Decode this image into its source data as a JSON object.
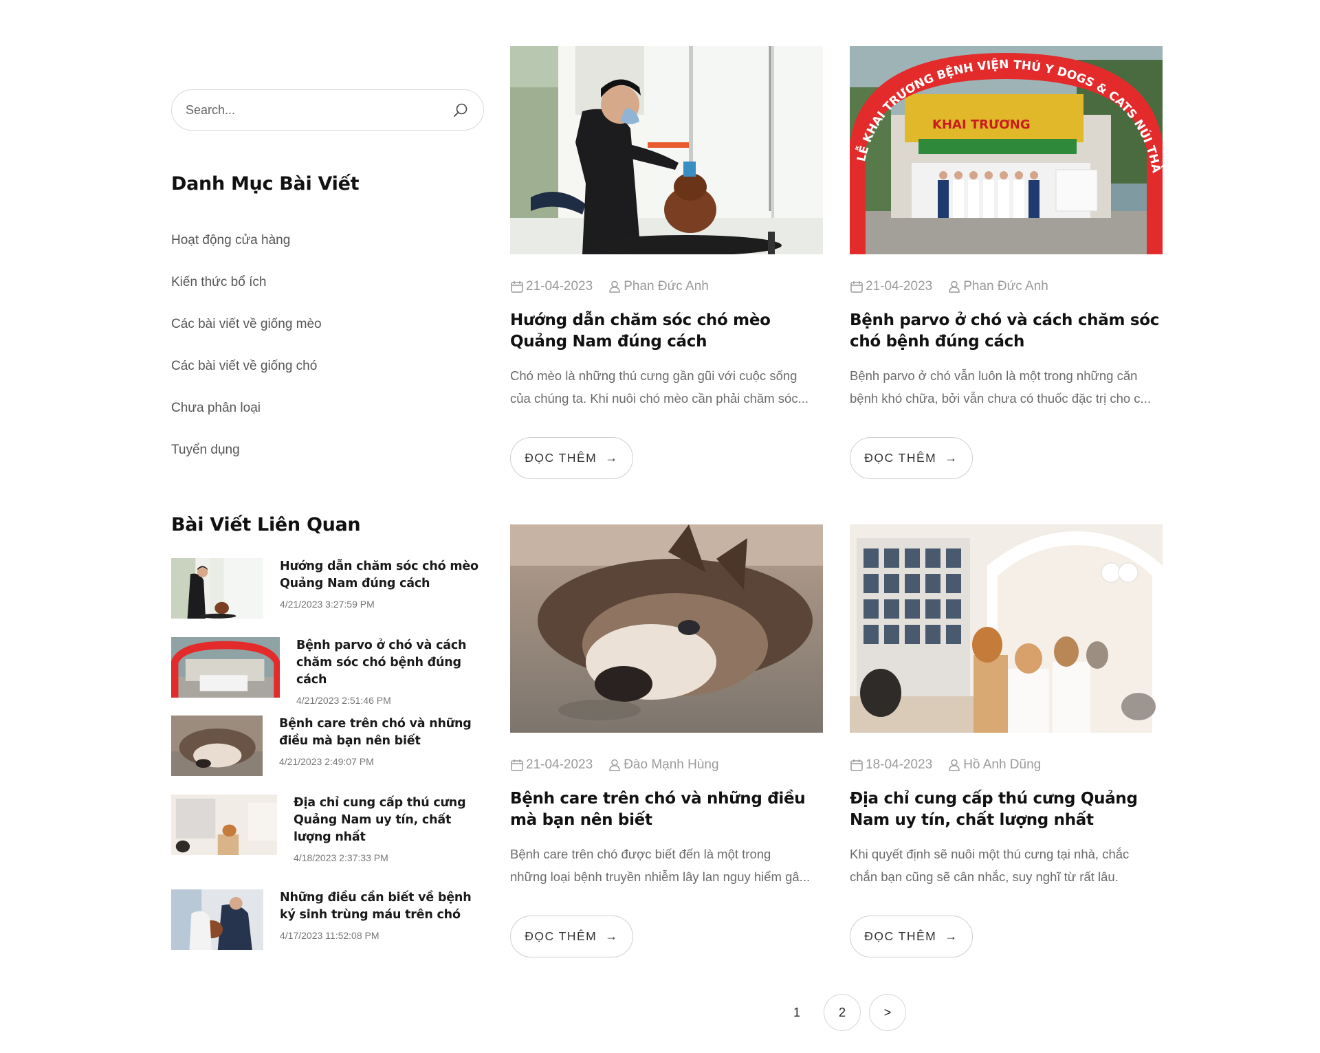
{
  "sidebar": {
    "search": {
      "placeholder": "Search..."
    },
    "categories_title": "Danh Mục Bài Viết",
    "categories": [
      "Hoạt động cửa hàng",
      "Kiến thức bổ ích",
      "Các bài viết về giống mèo",
      "Các bài viết về giống chó",
      "Chưa phân loại",
      "Tuyển dụng"
    ],
    "related_title": "Bài Viết Liên Quan",
    "related": [
      {
        "title": "Hướng dẫn chăm sóc chó mèo Quảng Nam đúng cách",
        "date": "4/21/2023 3:27:59 PM"
      },
      {
        "title": "Bệnh parvo ở chó và cách chăm sóc chó bệnh đúng cách",
        "date": "4/21/2023 2:51:46 PM"
      },
      {
        "title": "Bệnh care trên chó và những điều mà bạn nên biết",
        "date": "4/21/2023 2:49:07 PM"
      },
      {
        "title": "Địa chỉ cung cấp thú cưng Quảng Nam uy tín, chất lượng nhất",
        "date": "4/18/2023 2:37:33 PM"
      },
      {
        "title": "Những điều cần biết về bệnh ký sinh trùng máu trên chó",
        "date": "4/17/2023 11:52:08 PM"
      }
    ]
  },
  "posts": [
    {
      "date": "21-04-2023",
      "author": "Phan Đức Anh",
      "title": "Hướng dẫn chăm sóc chó mèo Quảng Nam đúng cách",
      "excerpt_line1": "Chó mèo là những thú cưng gần gũi với cuộc sống",
      "excerpt_line2": "của chúng ta. Khi nuôi chó mèo cần phải chăm sóc...",
      "read_more": "ĐỌC THÊM"
    },
    {
      "date": "21-04-2023",
      "author": "Phan Đức Anh",
      "title": "Bệnh parvo ở chó và cách chăm sóc chó bệnh đúng cách",
      "excerpt_line1": "Bệnh parvo ở chó vẫn luôn là một trong những căn",
      "excerpt_line2": "bệnh khó chữa, bởi vẫn chưa có thuốc đặc trị cho c...",
      "read_more": "ĐỌC THÊM",
      "image_banner_text": "LỄ KHAI TRƯƠNG BỆNH VIỆN THÚ Y DOGS & CATS NÚI THÀNH",
      "image_sign_text": "KHAI TRƯƠNG"
    },
    {
      "date": "21-04-2023",
      "author": "Đào Mạnh Hùng",
      "title": "Bệnh care trên chó và những điều mà bạn nên biết",
      "excerpt_line1": "Bệnh care trên chó được biết đến là một trong",
      "excerpt_line2": "những loại bệnh truyền nhiễm lây lan nguy hiểm gâ...",
      "read_more": "ĐỌC THÊM"
    },
    {
      "date": "18-04-2023",
      "author": "Hồ Anh Dũng",
      "title": "Địa chỉ cung cấp thú cưng Quảng Nam uy tín, chất lượng nhất",
      "excerpt_line1": "Khi quyết định sẽ nuôi một thú cưng tại nhà, chắc",
      "excerpt_line2": "chắn bạn cũng sẽ cân nhắc, suy nghĩ từ rất lâu.",
      "read_more": "ĐỌC THÊM"
    }
  ],
  "pagination": {
    "pages": [
      "1",
      "2"
    ],
    "current": "1",
    "next_label": ">"
  },
  "colors": {
    "title": "#111111",
    "meta": "#9a9a9a",
    "excerpt": "#6b6b6b",
    "border": "#d6d6d6",
    "banner_red": "#e32b2b"
  }
}
